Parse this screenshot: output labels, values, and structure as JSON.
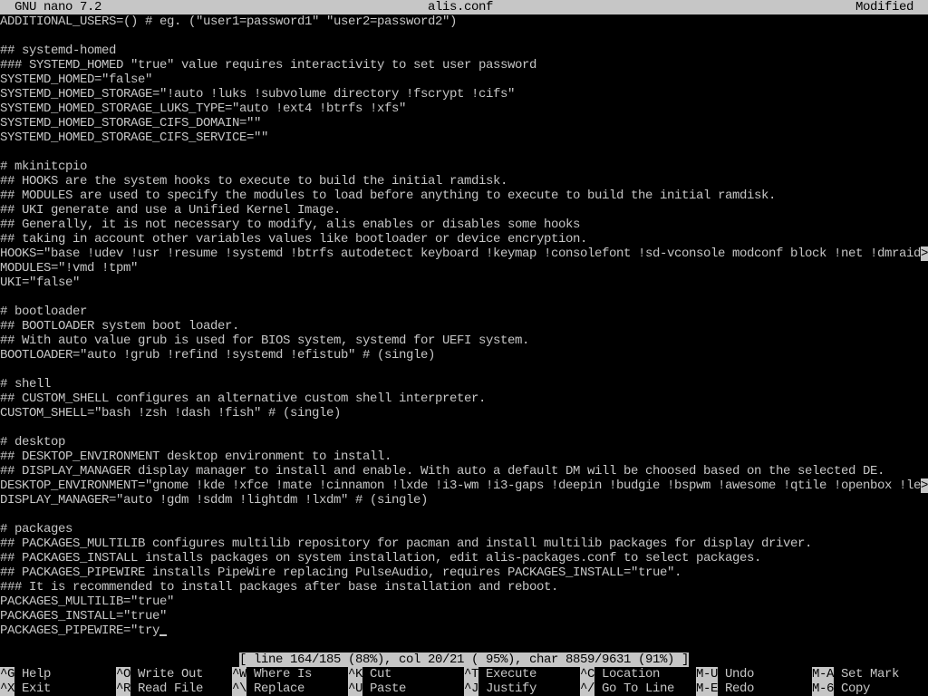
{
  "colors": {
    "background": "#000000",
    "foreground": "#c6c6c6",
    "inverse_background": "#c6c6c6",
    "inverse_foreground": "#000000"
  },
  "titlebar": {
    "app_version": "GNU nano 7.2",
    "filename": "alis.conf",
    "state": "Modified"
  },
  "editor": {
    "overflow_marker": ">",
    "lines": [
      {
        "text": "ADDITIONAL_USERS=() # eg. (\"user1=password1\" \"user2=password2\")"
      },
      {
        "text": ""
      },
      {
        "text": "## systemd-homed"
      },
      {
        "text": "### SYSTEMD_HOMED \"true\" value requires interactivity to set user password"
      },
      {
        "text": "SYSTEMD_HOMED=\"false\""
      },
      {
        "text": "SYSTEMD_HOMED_STORAGE=\"!auto !luks !subvolume directory !fscrypt !cifs\""
      },
      {
        "text": "SYSTEMD_HOMED_STORAGE_LUKS_TYPE=\"auto !ext4 !btrfs !xfs\""
      },
      {
        "text": "SYSTEMD_HOMED_STORAGE_CIFS_DOMAIN=\"\""
      },
      {
        "text": "SYSTEMD_HOMED_STORAGE_CIFS_SERVICE=\"\""
      },
      {
        "text": ""
      },
      {
        "text": "# mkinitcpio"
      },
      {
        "text": "## HOOKS are the system hooks to execute to build the initial ramdisk."
      },
      {
        "text": "## MODULES are used to specify the modules to load before anything to execute to build the initial ramdisk."
      },
      {
        "text": "## UKI generate and use a Unified Kernel Image."
      },
      {
        "text": "## Generally, it is not necessary to modify, alis enables or disables some hooks"
      },
      {
        "text": "## taking in account other variables values like bootloader or device encryption."
      },
      {
        "text": "HOOKS=\"base !udev !usr !resume !systemd !btrfs autodetect keyboard !keymap !consolefont !sd-vconsole modconf block !net !dmraid",
        "truncated": true
      },
      {
        "text": "MODULES=\"!vmd !tpm\""
      },
      {
        "text": "UKI=\"false\""
      },
      {
        "text": ""
      },
      {
        "text": "# bootloader"
      },
      {
        "text": "## BOOTLOADER system boot loader."
      },
      {
        "text": "## With auto value grub is used for BIOS system, systemd for UEFI system."
      },
      {
        "text": "BOOTLOADER=\"auto !grub !refind !systemd !efistub\" # (single)"
      },
      {
        "text": ""
      },
      {
        "text": "# shell"
      },
      {
        "text": "## CUSTOM_SHELL configures an alternative custom shell interpreter."
      },
      {
        "text": "CUSTOM_SHELL=\"bash !zsh !dash !fish\" # (single)"
      },
      {
        "text": ""
      },
      {
        "text": "# desktop"
      },
      {
        "text": "## DESKTOP_ENVIRONMENT desktop environment to install."
      },
      {
        "text": "## DISPLAY_MANAGER display manager to install and enable. With auto a default DM will be choosed based on the selected DE."
      },
      {
        "text": "DESKTOP_ENVIRONMENT=\"gnome !kde !xfce !mate !cinnamon !lxde !i3-wm !i3-gaps !deepin !budgie !bspwm !awesome !qtile !openbox !le",
        "truncated": true
      },
      {
        "text": "DISPLAY_MANAGER=\"auto !gdm !sddm !lightdm !lxdm\" # (single)"
      },
      {
        "text": ""
      },
      {
        "text": "# packages"
      },
      {
        "text": "## PACKAGES_MULTILIB configures multilib repository for pacman and install multilib packages for display driver."
      },
      {
        "text": "## PACKAGES_INSTALL installs packages on system installation, edit alis-packages.conf to select packages."
      },
      {
        "text": "## PACKAGES_PIPEWIRE installs PipeWire replacing PulseAudio, requires PACKAGES_INSTALL=\"true\"."
      },
      {
        "text": "### It is recommended to install packages after base installation and reboot."
      },
      {
        "text": "PACKAGES_MULTILIB=\"true\""
      },
      {
        "text": "PACKAGES_INSTALL=\"true\""
      },
      {
        "text": "PACKAGES_PIPEWIRE=\"try",
        "cursor": true
      },
      {
        "text": ""
      }
    ]
  },
  "statusbar": {
    "text": "[ line 164/185 (88%), col 20/21 ( 95%), char 8859/9631 (91%) ]"
  },
  "shortcuts": [
    [
      {
        "key": "^G",
        "label": "Help"
      },
      {
        "key": "^O",
        "label": "Write Out"
      },
      {
        "key": "^W",
        "label": "Where Is"
      },
      {
        "key": "^K",
        "label": "Cut"
      },
      {
        "key": "^T",
        "label": "Execute"
      },
      {
        "key": "^C",
        "label": "Location"
      },
      {
        "key": "M-U",
        "label": "Undo"
      },
      {
        "key": "M-A",
        "label": "Set Mark"
      }
    ],
    [
      {
        "key": "^X",
        "label": "Exit"
      },
      {
        "key": "^R",
        "label": "Read File"
      },
      {
        "key": "^\\",
        "label": "Replace"
      },
      {
        "key": "^U",
        "label": "Paste"
      },
      {
        "key": "^J",
        "label": "Justify"
      },
      {
        "key": "^/",
        "label": "Go To Line"
      },
      {
        "key": "M-E",
        "label": "Redo"
      },
      {
        "key": "M-6",
        "label": "Copy"
      }
    ]
  ]
}
